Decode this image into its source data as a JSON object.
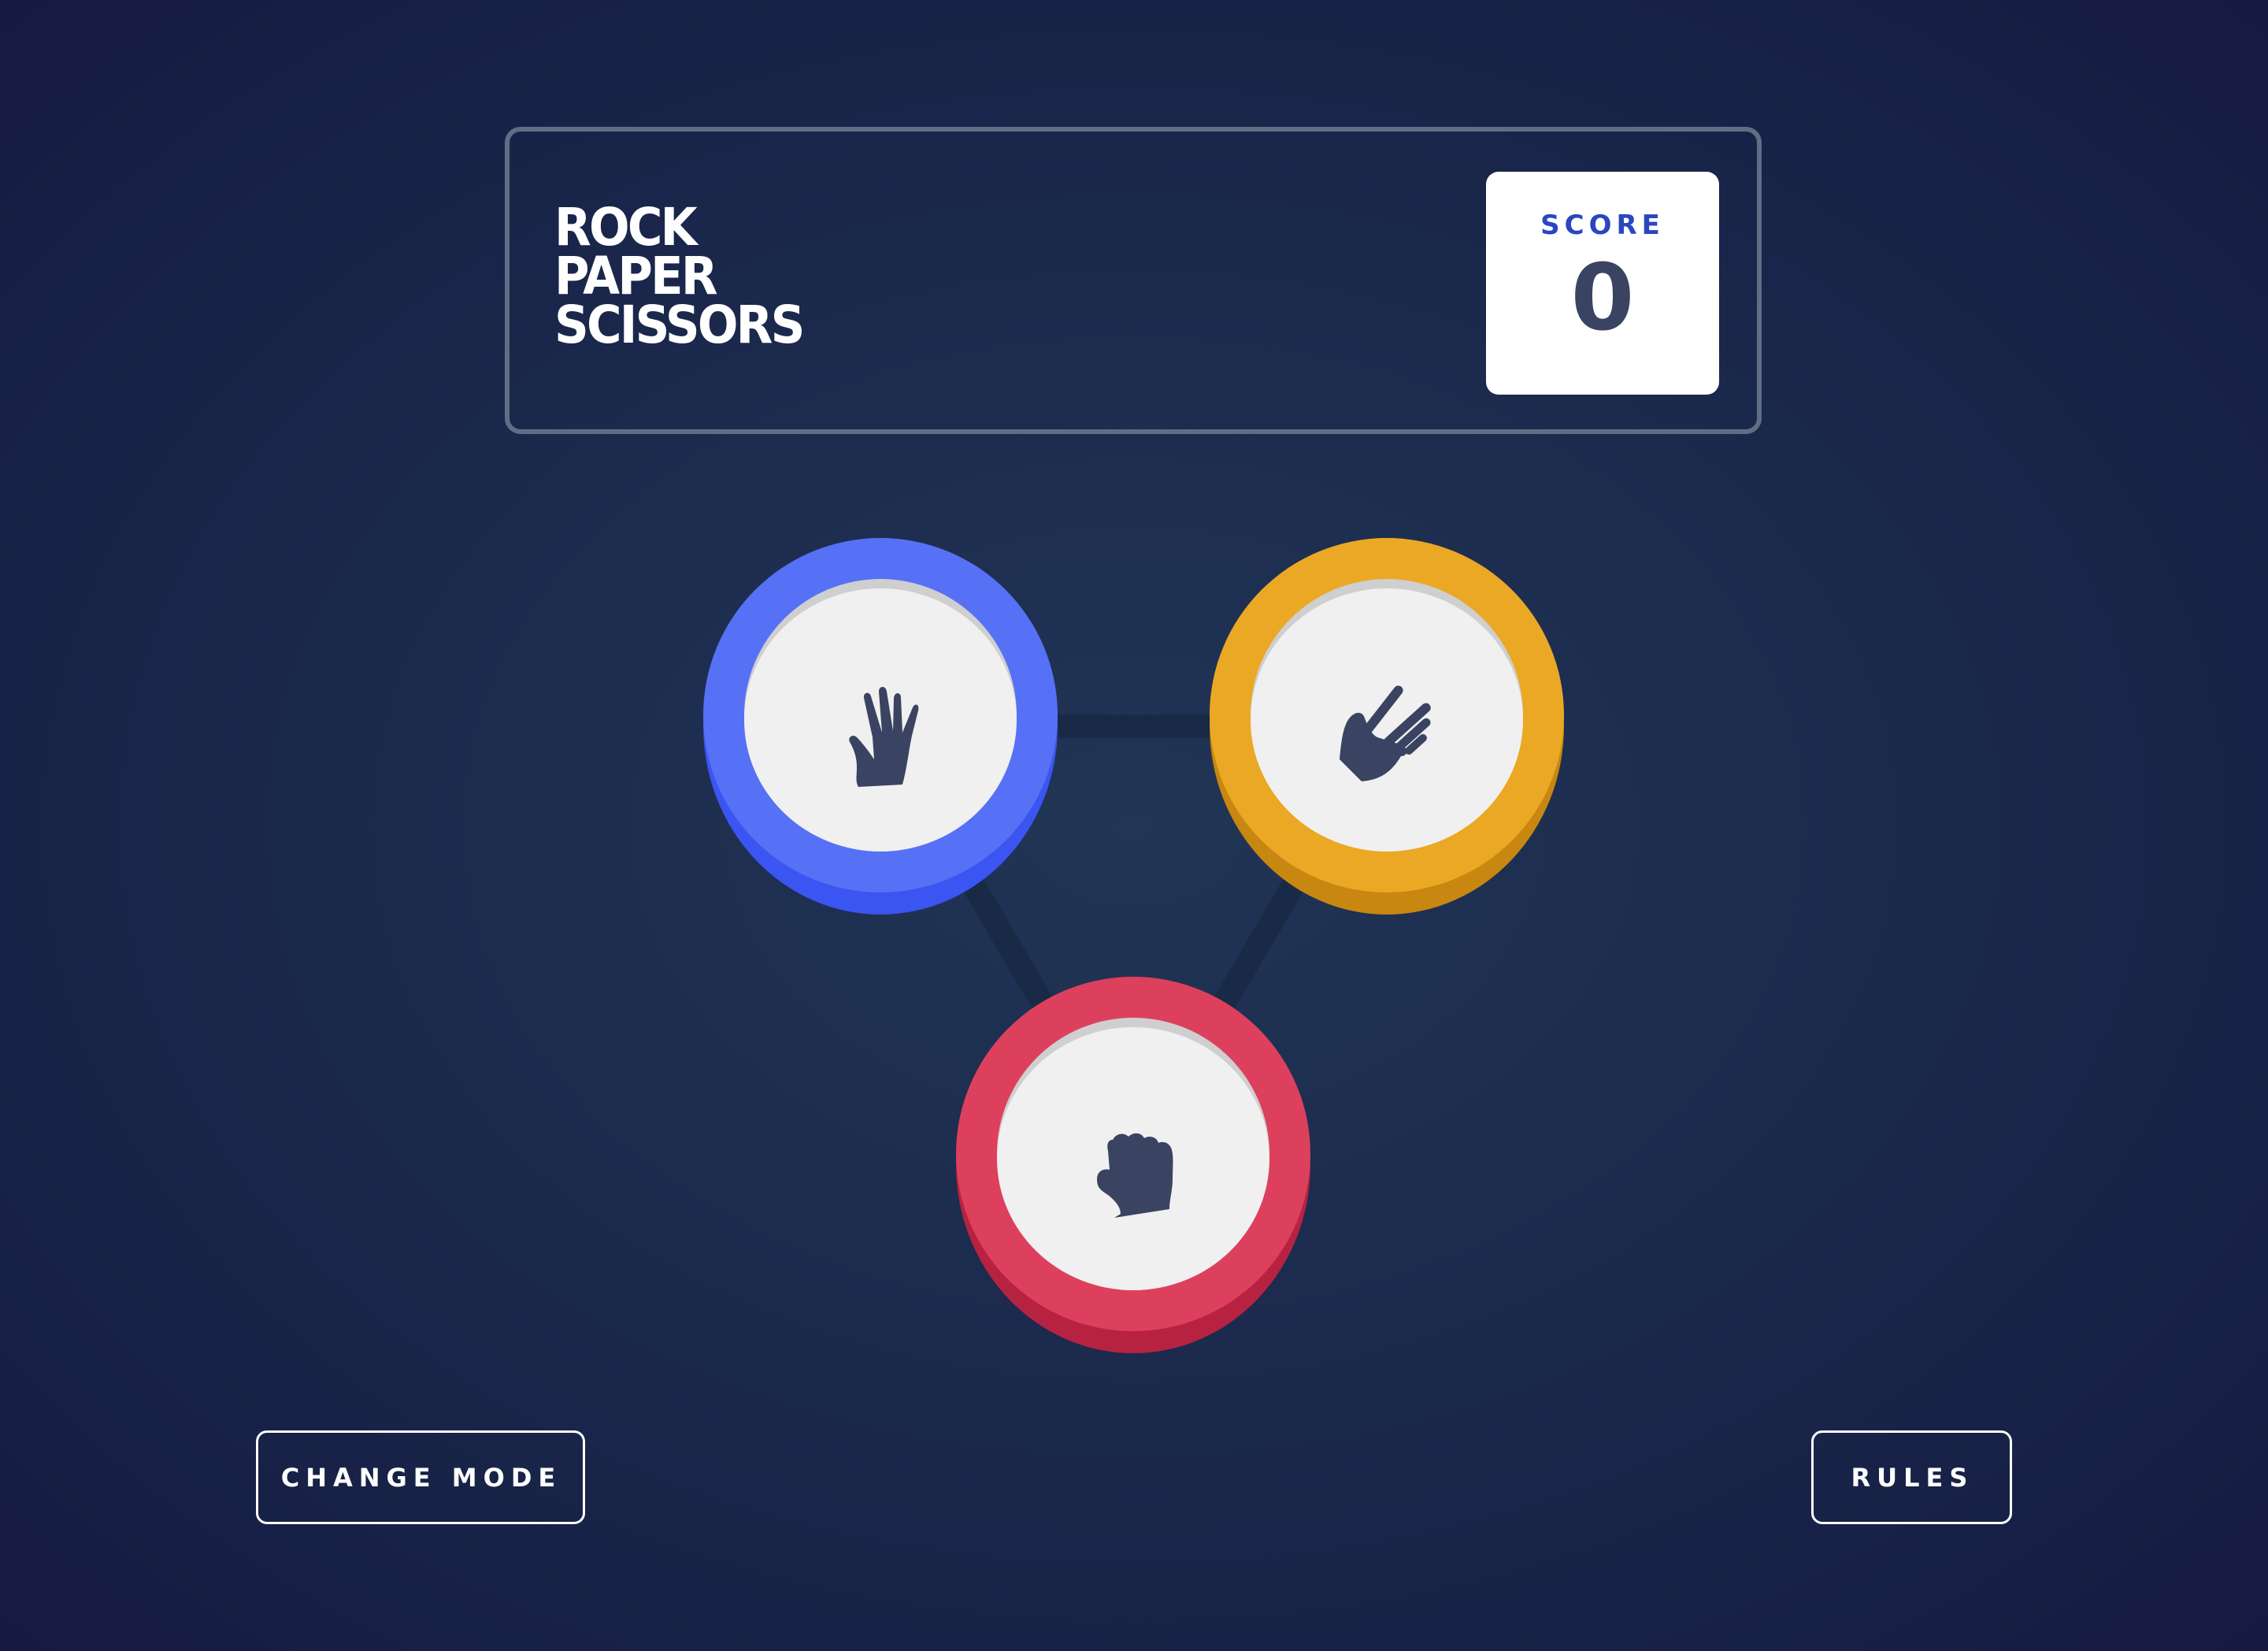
{
  "header": {
    "title_lines": [
      "ROCK",
      "PAPER",
      "SCISSORS"
    ],
    "score_label": "SCORE",
    "score_value": "0"
  },
  "choices": [
    {
      "name": "paper",
      "icon": "paper-hand-icon",
      "face_color": "#5671f5",
      "rim_color": "#3a55f1"
    },
    {
      "name": "scissors",
      "icon": "scissors-hand-icon",
      "face_color": "#eaa824",
      "rim_color": "#c78710"
    },
    {
      "name": "rock",
      "icon": "rock-fist-icon",
      "face_color": "#dd405d",
      "rim_color": "#b82241"
    }
  ],
  "footer": {
    "change_mode_label": "CHANGE MODE",
    "rules_label": "RULES"
  },
  "colors": {
    "background": "#1b2a4d",
    "header_border": "#606e85",
    "score_label": "#2a46c0",
    "score_value": "#3b4363",
    "icon": "#3b4363"
  }
}
